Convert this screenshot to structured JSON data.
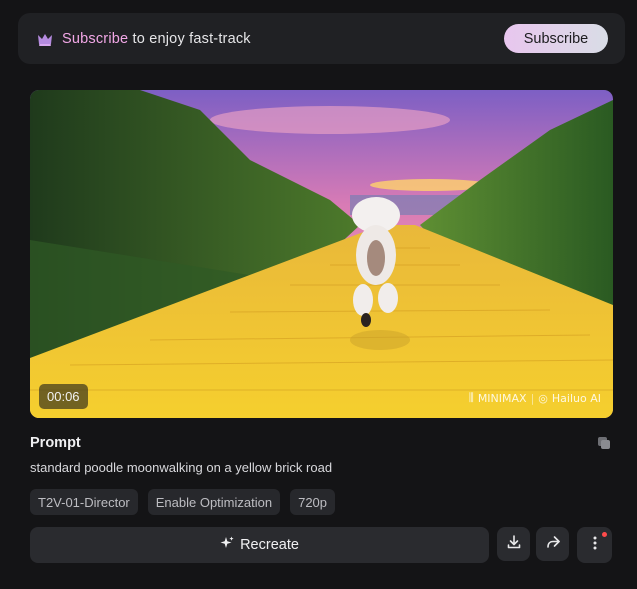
{
  "banner": {
    "highlight": "Subscribe",
    "text": " to enjoy fast-track",
    "button_label": "Subscribe",
    "icon": "crown-icon"
  },
  "video": {
    "duration": "00:06",
    "watermark_left": "MINIMAX",
    "watermark_right": "Hailuo AI"
  },
  "prompt": {
    "title": "Prompt",
    "text": "standard poodle moonwalking on a yellow brick road"
  },
  "tags": [
    "T2V-01-Director",
    "Enable Optimization",
    "720p"
  ],
  "actions": {
    "recreate_label": "Recreate",
    "download_icon": "download-icon",
    "share_icon": "share-icon",
    "more_icon": "more-vertical-icon",
    "notification_dot_color": "#ff4b4b"
  },
  "colors": {
    "accent_pink": "#f1a7e6",
    "background": "#141416"
  }
}
